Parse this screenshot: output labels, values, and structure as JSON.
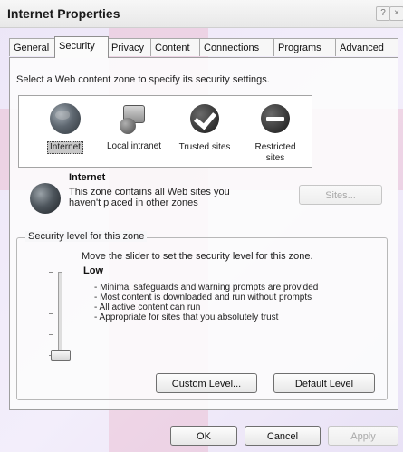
{
  "window": {
    "title": "Internet Properties"
  },
  "title_buttons": {
    "help": "?",
    "close": "×"
  },
  "tabs": [
    {
      "label": "General"
    },
    {
      "label": "Security"
    },
    {
      "label": "Privacy"
    },
    {
      "label": "Content"
    },
    {
      "label": "Connections"
    },
    {
      "label": "Programs"
    },
    {
      "label": "Advanced"
    }
  ],
  "security": {
    "instruction": "Select a Web content zone to specify its security settings.",
    "zones": [
      {
        "label_lines": [
          "Internet"
        ],
        "icon": "globe-icon",
        "selected": true
      },
      {
        "label_lines": [
          "Local intranet"
        ],
        "icon": "computer-globe-icon",
        "selected": false
      },
      {
        "label_lines": [
          "Trusted sites"
        ],
        "icon": "checkmark-icon",
        "selected": false
      },
      {
        "label_lines": [
          "Restricted",
          "sites"
        ],
        "icon": "no-entry-icon",
        "selected": false
      }
    ],
    "zone_info": {
      "name": "Internet",
      "description": "This zone contains all Web sites you haven't placed in other zones",
      "sites_button": "Sites..."
    },
    "security_level": {
      "group_label": "Security level for this zone",
      "instruction": "Move the slider to set the security level for this zone.",
      "level": "Low",
      "bullets": [
        "- Minimal safeguards and warning prompts are provided",
        "- Most content is downloaded and run without prompts",
        "- All active content can run",
        "- Appropriate for sites that you absolutely trust"
      ],
      "slider_level_fraction": 0.0,
      "custom_level_button": "Custom Level...",
      "default_level_button": "Default Level"
    }
  },
  "footer": {
    "ok": "OK",
    "cancel": "Cancel",
    "apply": "Apply"
  }
}
